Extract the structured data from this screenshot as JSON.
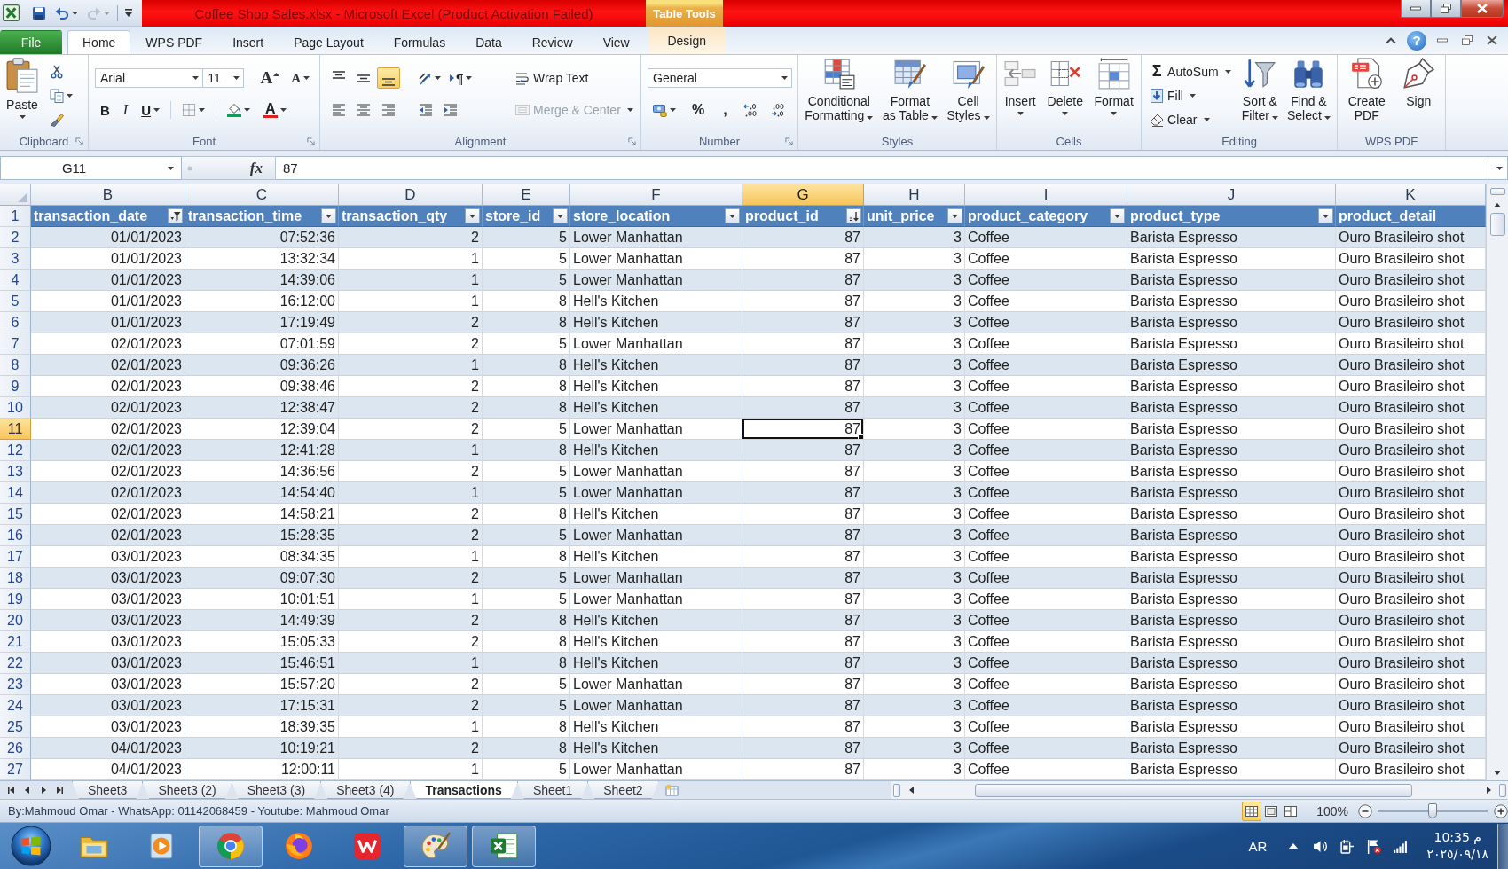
{
  "title_bar": {
    "quick_access": [
      {
        "kind": "save",
        "disabled": false,
        "dropdown": false
      },
      {
        "kind": "undo",
        "disabled": false,
        "dropdown": true
      },
      {
        "kind": "redo",
        "disabled": true,
        "dropdown": true
      },
      {
        "kind": "customize",
        "disabled": false,
        "dropdown": false
      }
    ],
    "title": "Coffee Shop Sales.xlsx - Microsoft Excel (Product Activation Failed)",
    "contextual_group": "Table Tools"
  },
  "ribbon": {
    "tabs": [
      {
        "label": "File",
        "kind": "file",
        "selected": false
      },
      {
        "label": "Home",
        "kind": "standard",
        "selected": true
      },
      {
        "label": "WPS PDF",
        "kind": "standard",
        "selected": false
      },
      {
        "label": "Insert",
        "kind": "standard",
        "selected": false
      },
      {
        "label": "Page Layout",
        "kind": "standard",
        "selected": false
      },
      {
        "label": "Formulas",
        "kind": "standard",
        "selected": false
      },
      {
        "label": "Data",
        "kind": "standard",
        "selected": false
      },
      {
        "label": "Review",
        "kind": "standard",
        "selected": false
      },
      {
        "label": "View",
        "kind": "standard",
        "selected": false
      },
      {
        "label": "Design",
        "kind": "contextual",
        "selected": false
      }
    ],
    "help_label": "?",
    "groups": [
      {
        "kind": "clipboard",
        "label": "Clipboard",
        "launcher": true,
        "paste": {
          "label": "Paste",
          "dropdown": true
        },
        "tools": [
          {
            "kind": "cut",
            "dropdown": false
          },
          {
            "kind": "copy",
            "dropdown": true
          },
          {
            "kind": "format_painter",
            "dropdown": false
          }
        ]
      },
      {
        "kind": "font",
        "label": "Font",
        "launcher": true,
        "font_name": "Arial",
        "font_size": "11",
        "size_buttons": [
          {
            "kind": "grow",
            "label": "A"
          },
          {
            "kind": "shrink",
            "label": "A"
          }
        ],
        "format_buttons": [
          {
            "kind": "bold",
            "label": "B",
            "dropdown": false
          },
          {
            "kind": "italic",
            "label": "I",
            "dropdown": false
          },
          {
            "kind": "underline",
            "label": "U",
            "dropdown": true
          },
          {
            "kind": "borders",
            "dropdown": true
          },
          {
            "kind": "fill_color",
            "dropdown": true
          },
          {
            "kind": "font_color",
            "label": "A",
            "dropdown": true
          }
        ]
      },
      {
        "kind": "alignment",
        "label": "Alignment",
        "launcher": true,
        "vertical": [
          {
            "kind": "top",
            "selected": false
          },
          {
            "kind": "middle",
            "selected": false
          },
          {
            "kind": "bottom",
            "selected": true
          }
        ],
        "orientation": {
          "dropdown": true
        },
        "text_direction": {
          "label": "¶",
          "dropdown": true
        },
        "wrap_text": {
          "label": "Wrap Text",
          "disabled": false
        },
        "horizontal": [
          {
            "kind": "left",
            "selected": false
          },
          {
            "kind": "center",
            "selected": false
          },
          {
            "kind": "right",
            "selected": false
          }
        ],
        "indent": [
          {
            "kind": "decrease"
          },
          {
            "kind": "increase"
          }
        ],
        "merge": {
          "label": "Merge & Center",
          "disabled": true,
          "dropdown": true
        }
      },
      {
        "kind": "number",
        "label": "Number",
        "launcher": true,
        "format": "General",
        "buttons": [
          {
            "kind": "accounting",
            "dropdown": true
          },
          {
            "kind": "percent",
            "label": "%",
            "dropdown": false
          },
          {
            "kind": "comma",
            "label": ",",
            "dropdown": false
          },
          {
            "kind": "increase_decimal",
            "dropdown": false
          },
          {
            "kind": "decrease_decimal",
            "dropdown": false
          }
        ]
      },
      {
        "kind": "styles",
        "label": "Styles",
        "launcher": false,
        "buttons": [
          {
            "kind": "conditional_formatting",
            "label": "Conditional\nFormatting",
            "dropdown": true
          },
          {
            "kind": "format_as_table",
            "label": "Format\nas Table",
            "dropdown": true
          },
          {
            "kind": "cell_styles",
            "label": "Cell\nStyles",
            "dropdown": true
          }
        ]
      },
      {
        "kind": "cells",
        "label": "Cells",
        "launcher": false,
        "buttons": [
          {
            "kind": "insert",
            "label": "Insert",
            "dropdown": true
          },
          {
            "kind": "delete",
            "label": "Delete",
            "dropdown": true
          },
          {
            "kind": "format",
            "label": "Format",
            "dropdown": true
          }
        ]
      },
      {
        "kind": "editing",
        "label": "Editing",
        "launcher": false,
        "small": [
          {
            "kind": "autosum",
            "symbol": "Σ",
            "label": "AutoSum",
            "dropdown": true
          },
          {
            "kind": "fill",
            "label": "Fill",
            "dropdown": true
          },
          {
            "kind": "clear",
            "label": "Clear",
            "dropdown": true
          }
        ],
        "buttons": [
          {
            "kind": "sort_filter",
            "label": "Sort &\nFilter",
            "dropdown": true
          },
          {
            "kind": "find_select",
            "label": "Find &\nSelect",
            "dropdown": true
          }
        ]
      },
      {
        "kind": "wps_pdf",
        "label": "WPS PDF",
        "launcher": false,
        "buttons": [
          {
            "kind": "create_pdf",
            "label": "Create\nPDF",
            "dropdown": false
          },
          {
            "kind": "sign",
            "label": "Sign",
            "dropdown": false
          }
        ]
      }
    ]
  },
  "formula_bar": {
    "name_box": "G11",
    "function_label": "fx",
    "formula": "87"
  },
  "sheet": {
    "columns": [
      {
        "letter": "B",
        "kind": "number",
        "selected": false
      },
      {
        "letter": "C",
        "kind": "number",
        "selected": false
      },
      {
        "letter": "D",
        "kind": "number",
        "selected": false
      },
      {
        "letter": "E",
        "kind": "number",
        "selected": false
      },
      {
        "letter": "F",
        "kind": "text",
        "selected": false
      },
      {
        "letter": "G",
        "kind": "number",
        "selected": true
      },
      {
        "letter": "H",
        "kind": "number",
        "selected": false
      },
      {
        "letter": "I",
        "kind": "text",
        "selected": false
      },
      {
        "letter": "J",
        "kind": "text",
        "selected": false
      },
      {
        "letter": "K",
        "kind": "text",
        "selected": false
      }
    ],
    "header_row": {
      "number": "1",
      "selected": false,
      "cells": [
        {
          "text": "transaction_date",
          "filter_button": true,
          "filtered": true,
          "sorted": false
        },
        {
          "text": "transaction_time",
          "filter_button": true,
          "filtered": false,
          "sorted": false
        },
        {
          "text": "transaction_qty",
          "filter_button": true,
          "filtered": false,
          "sorted": false
        },
        {
          "text": "store_id",
          "filter_button": true,
          "filtered": false,
          "sorted": false
        },
        {
          "text": "store_location",
          "filter_button": true,
          "filtered": false,
          "sorted": false
        },
        {
          "text": "product_id",
          "filter_button": true,
          "filtered": false,
          "sorted": true
        },
        {
          "text": "unit_price",
          "filter_button": true,
          "filtered": false,
          "sorted": false
        },
        {
          "text": "product_category",
          "filter_button": true,
          "filtered": false,
          "sorted": false
        },
        {
          "text": "product_type",
          "filter_button": true,
          "filtered": false,
          "sorted": false
        },
        {
          "text": "product_detail",
          "filter_button": false
        }
      ]
    },
    "rows": [
      {
        "number": "2",
        "selected": false,
        "cells": [
          "01/01/2023",
          "07:52:36",
          "2",
          "5",
          "Lower Manhattan",
          "87",
          "3",
          "Coffee",
          "Barista Espresso",
          "Ouro Brasileiro shot"
        ]
      },
      {
        "number": "3",
        "selected": false,
        "cells": [
          "01/01/2023",
          "13:32:34",
          "1",
          "5",
          "Lower Manhattan",
          "87",
          "3",
          "Coffee",
          "Barista Espresso",
          "Ouro Brasileiro shot"
        ]
      },
      {
        "number": "4",
        "selected": false,
        "cells": [
          "01/01/2023",
          "14:39:06",
          "1",
          "5",
          "Lower Manhattan",
          "87",
          "3",
          "Coffee",
          "Barista Espresso",
          "Ouro Brasileiro shot"
        ]
      },
      {
        "number": "5",
        "selected": false,
        "cells": [
          "01/01/2023",
          "16:12:00",
          "1",
          "8",
          "Hell's Kitchen",
          "87",
          "3",
          "Coffee",
          "Barista Espresso",
          "Ouro Brasileiro shot"
        ]
      },
      {
        "number": "6",
        "selected": false,
        "cells": [
          "01/01/2023",
          "17:19:49",
          "2",
          "8",
          "Hell's Kitchen",
          "87",
          "3",
          "Coffee",
          "Barista Espresso",
          "Ouro Brasileiro shot"
        ]
      },
      {
        "number": "7",
        "selected": false,
        "cells": [
          "02/01/2023",
          "07:01:59",
          "2",
          "5",
          "Lower Manhattan",
          "87",
          "3",
          "Coffee",
          "Barista Espresso",
          "Ouro Brasileiro shot"
        ]
      },
      {
        "number": "8",
        "selected": false,
        "cells": [
          "02/01/2023",
          "09:36:26",
          "1",
          "8",
          "Hell's Kitchen",
          "87",
          "3",
          "Coffee",
          "Barista Espresso",
          "Ouro Brasileiro shot"
        ]
      },
      {
        "number": "9",
        "selected": false,
        "cells": [
          "02/01/2023",
          "09:38:46",
          "2",
          "8",
          "Hell's Kitchen",
          "87",
          "3",
          "Coffee",
          "Barista Espresso",
          "Ouro Brasileiro shot"
        ]
      },
      {
        "number": "10",
        "selected": false,
        "cells": [
          "02/01/2023",
          "12:38:47",
          "2",
          "8",
          "Hell's Kitchen",
          "87",
          "3",
          "Coffee",
          "Barista Espresso",
          "Ouro Brasileiro shot"
        ]
      },
      {
        "number": "11",
        "selected": true,
        "cells": [
          "02/01/2023",
          "12:39:04",
          "2",
          "5",
          "Lower Manhattan",
          "87",
          "3",
          "Coffee",
          "Barista Espresso",
          "Ouro Brasileiro shot"
        ]
      },
      {
        "number": "12",
        "selected": false,
        "cells": [
          "02/01/2023",
          "12:41:28",
          "1",
          "8",
          "Hell's Kitchen",
          "87",
          "3",
          "Coffee",
          "Barista Espresso",
          "Ouro Brasileiro shot"
        ]
      },
      {
        "number": "13",
        "selected": false,
        "cells": [
          "02/01/2023",
          "14:36:56",
          "2",
          "5",
          "Lower Manhattan",
          "87",
          "3",
          "Coffee",
          "Barista Espresso",
          "Ouro Brasileiro shot"
        ]
      },
      {
        "number": "14",
        "selected": false,
        "cells": [
          "02/01/2023",
          "14:54:40",
          "1",
          "5",
          "Lower Manhattan",
          "87",
          "3",
          "Coffee",
          "Barista Espresso",
          "Ouro Brasileiro shot"
        ]
      },
      {
        "number": "15",
        "selected": false,
        "cells": [
          "02/01/2023",
          "14:58:21",
          "2",
          "8",
          "Hell's Kitchen",
          "87",
          "3",
          "Coffee",
          "Barista Espresso",
          "Ouro Brasileiro shot"
        ]
      },
      {
        "number": "16",
        "selected": false,
        "cells": [
          "02/01/2023",
          "15:28:35",
          "2",
          "5",
          "Lower Manhattan",
          "87",
          "3",
          "Coffee",
          "Barista Espresso",
          "Ouro Brasileiro shot"
        ]
      },
      {
        "number": "17",
        "selected": false,
        "cells": [
          "03/01/2023",
          "08:34:35",
          "1",
          "8",
          "Hell's Kitchen",
          "87",
          "3",
          "Coffee",
          "Barista Espresso",
          "Ouro Brasileiro shot"
        ]
      },
      {
        "number": "18",
        "selected": false,
        "cells": [
          "03/01/2023",
          "09:07:30",
          "2",
          "5",
          "Lower Manhattan",
          "87",
          "3",
          "Coffee",
          "Barista Espresso",
          "Ouro Brasileiro shot"
        ]
      },
      {
        "number": "19",
        "selected": false,
        "cells": [
          "03/01/2023",
          "10:01:51",
          "1",
          "5",
          "Lower Manhattan",
          "87",
          "3",
          "Coffee",
          "Barista Espresso",
          "Ouro Brasileiro shot"
        ]
      },
      {
        "number": "20",
        "selected": false,
        "cells": [
          "03/01/2023",
          "14:49:39",
          "2",
          "8",
          "Hell's Kitchen",
          "87",
          "3",
          "Coffee",
          "Barista Espresso",
          "Ouro Brasileiro shot"
        ]
      },
      {
        "number": "21",
        "selected": false,
        "cells": [
          "03/01/2023",
          "15:05:33",
          "2",
          "8",
          "Hell's Kitchen",
          "87",
          "3",
          "Coffee",
          "Barista Espresso",
          "Ouro Brasileiro shot"
        ]
      },
      {
        "number": "22",
        "selected": false,
        "cells": [
          "03/01/2023",
          "15:46:51",
          "1",
          "8",
          "Hell's Kitchen",
          "87",
          "3",
          "Coffee",
          "Barista Espresso",
          "Ouro Brasileiro shot"
        ]
      },
      {
        "number": "23",
        "selected": false,
        "cells": [
          "03/01/2023",
          "15:57:20",
          "2",
          "5",
          "Lower Manhattan",
          "87",
          "3",
          "Coffee",
          "Barista Espresso",
          "Ouro Brasileiro shot"
        ]
      },
      {
        "number": "24",
        "selected": false,
        "cells": [
          "03/01/2023",
          "17:15:31",
          "2",
          "5",
          "Lower Manhattan",
          "87",
          "3",
          "Coffee",
          "Barista Espresso",
          "Ouro Brasileiro shot"
        ]
      },
      {
        "number": "25",
        "selected": false,
        "cells": [
          "03/01/2023",
          "18:39:35",
          "1",
          "8",
          "Hell's Kitchen",
          "87",
          "3",
          "Coffee",
          "Barista Espresso",
          "Ouro Brasileiro shot"
        ]
      },
      {
        "number": "26",
        "selected": false,
        "cells": [
          "04/01/2023",
          "10:19:21",
          "2",
          "8",
          "Hell's Kitchen",
          "87",
          "3",
          "Coffee",
          "Barista Espresso",
          "Ouro Brasileiro shot"
        ]
      },
      {
        "number": "27",
        "selected": false,
        "cells": [
          "04/01/2023",
          "12:00:11",
          "1",
          "5",
          "Lower Manhattan",
          "87",
          "3",
          "Coffee",
          "Barista Espresso",
          "Ouro Brasileiro shot"
        ]
      }
    ]
  },
  "sheet_tabs": {
    "tabs": [
      {
        "label": "Sheet3",
        "selected": false
      },
      {
        "label": "Sheet3 (2)",
        "selected": false
      },
      {
        "label": "Sheet3 (3)",
        "selected": false
      },
      {
        "label": "Sheet3 (4)",
        "selected": false
      },
      {
        "label": "Transactions",
        "selected": true
      },
      {
        "label": "Sheet1",
        "selected": false
      },
      {
        "label": "Sheet2",
        "selected": false
      }
    ]
  },
  "status_bar": {
    "text": "By:Mahmoud Omar - WhatsApp: 01142068459 - Youtube: Mahmoud Omar",
    "views": [
      {
        "kind": "normal",
        "selected": true
      },
      {
        "kind": "page_layout",
        "selected": false
      },
      {
        "kind": "page_break",
        "selected": false
      }
    ],
    "zoom": "100%",
    "zoom_slider": {
      "level": 0.5
    }
  },
  "taskbar": {
    "apps": [
      {
        "kind": "explorer",
        "running": false
      },
      {
        "kind": "media_player",
        "running": false
      },
      {
        "kind": "chrome",
        "running": true
      },
      {
        "kind": "firefox",
        "running": false
      },
      {
        "kind": "wps",
        "running": false
      },
      {
        "kind": "paint",
        "running": true
      },
      {
        "kind": "excel",
        "running": true
      }
    ],
    "language": "AR",
    "clock": {
      "time": "10:35 م",
      "date": "٢٠٢٥/٠٩/١٨"
    }
  }
}
